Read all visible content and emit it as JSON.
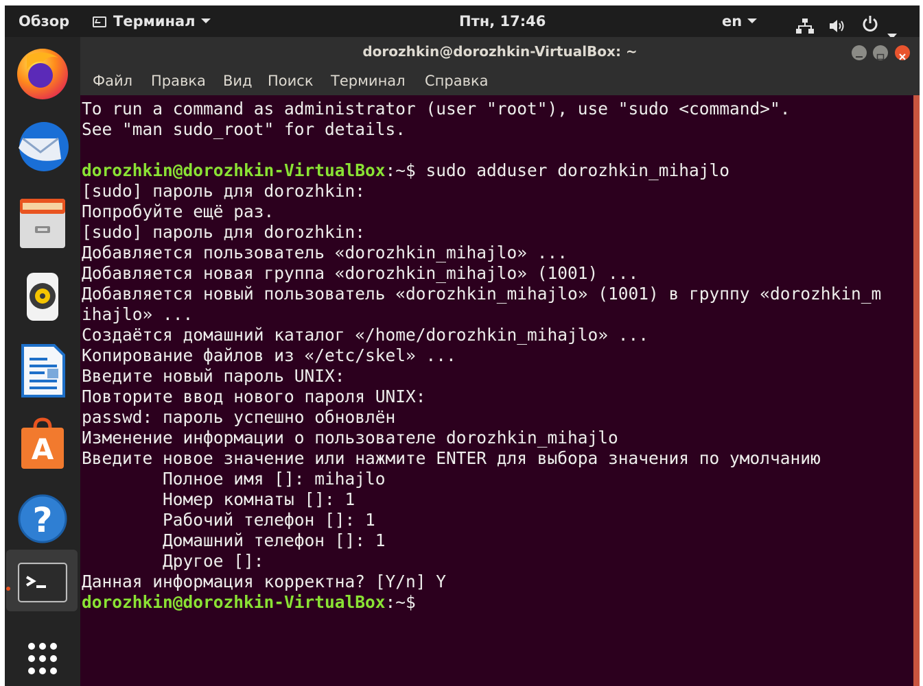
{
  "topbar": {
    "activities": "Обзор",
    "app_name": "Терминал",
    "clock": "Птн, 17:46",
    "language": "en",
    "icons": [
      "terminal-app-icon",
      "network-icon",
      "volume-icon",
      "power-icon",
      "chevron-down-icon"
    ]
  },
  "dock": {
    "items": [
      "firefox-icon",
      "thunderbird-icon",
      "files-icon",
      "rhythmbox-icon",
      "libreoffice-writer-icon",
      "ubuntu-software-icon",
      "help-icon",
      "terminal-icon",
      "show-applications-icon"
    ]
  },
  "window": {
    "title": "dorozhkin@dorozhkin-VirtualBox: ~",
    "menu": [
      "Файл",
      "Правка",
      "Вид",
      "Поиск",
      "Терминал",
      "Справка"
    ],
    "scrollbar_color": "#c8553f",
    "background_color": "#2c001e",
    "prompt_color": "#8ae234"
  },
  "terminal": {
    "prompt_user": "dorozhkin@dorozhkin-VirtualBox",
    "prompt_path": ":~$",
    "lines": [
      "To run a command as administrator (user \"root\"), use \"sudo <command>\".",
      "See \"man sudo_root\" for details.",
      "",
      " sudo adduser dorozhkin_mihajlo",
      "[sudo] пароль для dorozhkin:",
      "Попробуйте ещё раз.",
      "[sudo] пароль для dorozhkin:",
      "Добавляется пользователь «dorozhkin_mihajlo» ...",
      "Добавляется новая группа «dorozhkin_mihajlo» (1001) ...",
      "Добавляется новый пользователь «dorozhkin_mihajlo» (1001) в группу «dorozhkin_m",
      "ihajlo» ...",
      "Создаётся домашний каталог «/home/dorozhkin_mihajlo» ...",
      "Копирование файлов из «/etc/skel» ...",
      "Введите новый пароль UNIX:",
      "Повторите ввод нового пароля UNIX:",
      "passwd: пароль успешно обновлён",
      "Изменение информации о пользователе dorozhkin_mihajlo",
      "Введите новое значение или нажмите ENTER для выбора значения по умолчанию",
      "        Полное имя []: mihajlo",
      "        Номер комнаты []: 1",
      "        Рабочий телефон []: 1",
      "        Домашний телефон []: 1",
      "        Другое []:",
      "Данная информация корректна? [Y/n] Y",
      ""
    ]
  }
}
